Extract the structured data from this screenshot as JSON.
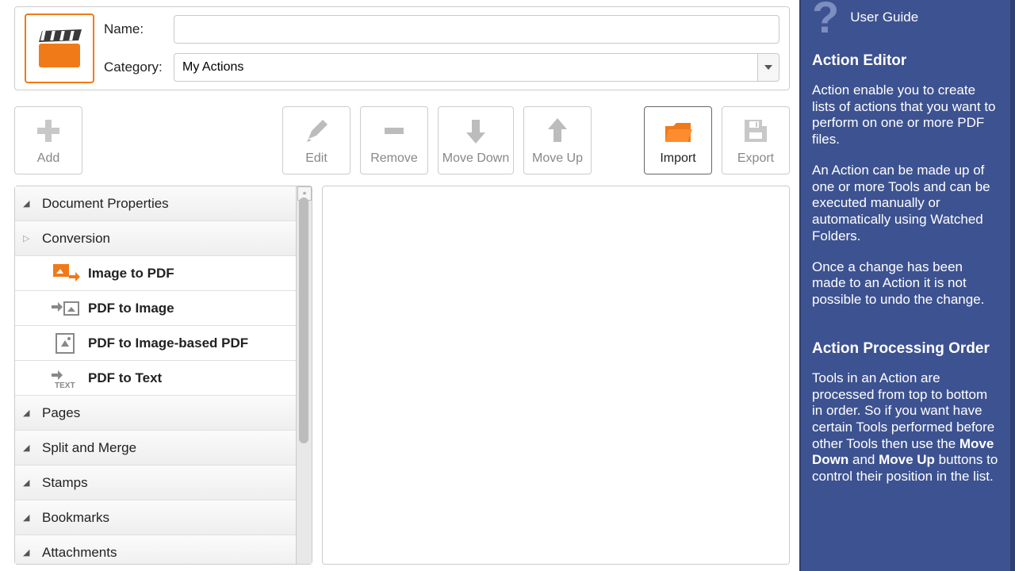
{
  "header": {
    "name_label": "Name:",
    "name_value": "",
    "category_label": "Category:",
    "category_value": "My Actions"
  },
  "toolbar": {
    "add": "Add",
    "edit": "Edit",
    "remove": "Remove",
    "move_down": "Move Down",
    "move_up": "Move Up",
    "import": "Import",
    "export": "Export"
  },
  "tree": {
    "doc_props": "Document Properties",
    "conversion": "Conversion",
    "image_to_pdf": "Image to PDF",
    "pdf_to_image": "PDF to Image",
    "pdf_to_image_based": "PDF to Image-based PDF",
    "pdf_to_text": "PDF to Text",
    "pages": "Pages",
    "split_merge": "Split and Merge",
    "stamps": "Stamps",
    "bookmarks": "Bookmarks",
    "attachments": "Attachments"
  },
  "sidebar": {
    "user_guide": "User Guide",
    "title1": "Action Editor",
    "p1": "Action enable you to create lists of actions that you want to perform on one or more PDF files.",
    "p2": "An Action can be made up of one or more Tools and can be executed manually or automatically using Watched Folders.",
    "p3": "Once a change has been made to an Action it is not possible to undo the change.",
    "title2": "Action Processing Order",
    "p4a": "Tools in an Action are processed from top to bottom in order. So if you want have certain Tools performed before other Tools then use the ",
    "p4b": "Move Down",
    "p4c": " and ",
    "p4d": "Move Up",
    "p4e": " buttons to control their position in the list."
  }
}
